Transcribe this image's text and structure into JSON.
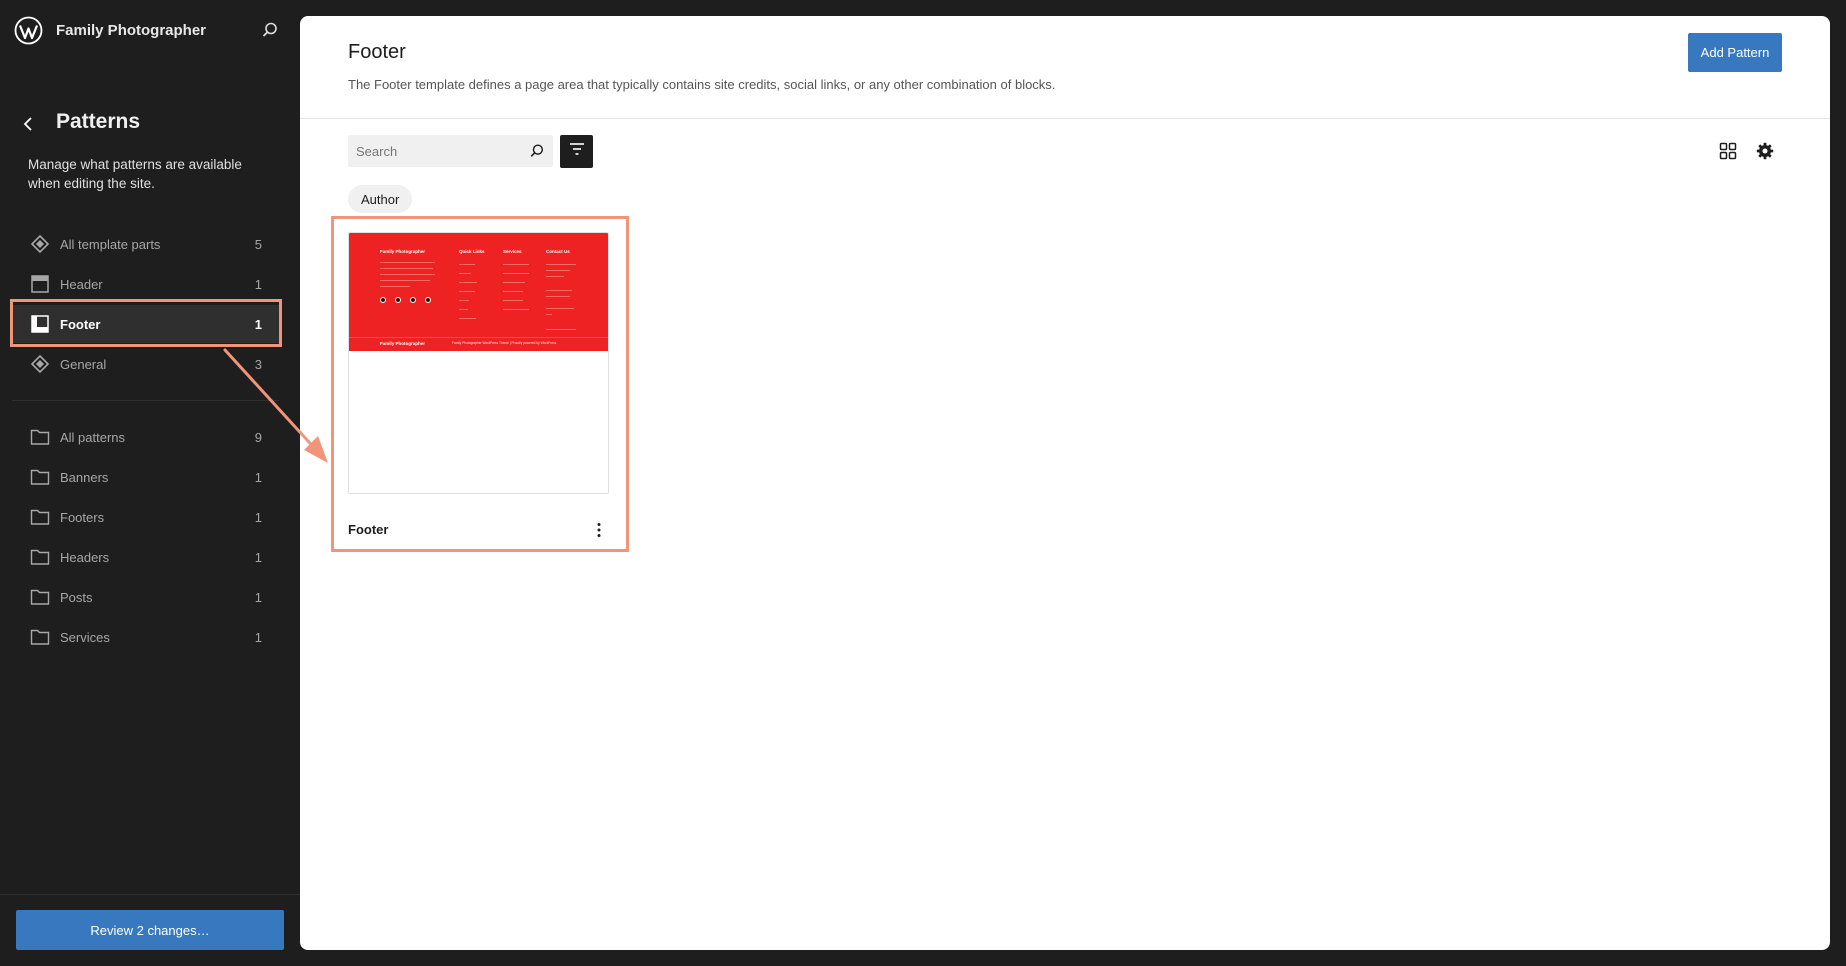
{
  "site": {
    "name": "Family Photographer"
  },
  "panel": {
    "title": "Patterns",
    "description": "Manage what patterns are available when editing the site."
  },
  "nav": {
    "template_parts": [
      {
        "label": "All template parts",
        "count": "5",
        "icon": "symbol-icon"
      },
      {
        "label": "Header",
        "count": "1",
        "icon": "header-icon"
      },
      {
        "label": "Footer",
        "count": "1",
        "icon": "footer-icon",
        "active": true
      },
      {
        "label": "General",
        "count": "3",
        "icon": "symbol-icon"
      }
    ],
    "patterns": [
      {
        "label": "All patterns",
        "count": "9",
        "icon": "folder-icon"
      },
      {
        "label": "Banners",
        "count": "1",
        "icon": "folder-icon"
      },
      {
        "label": "Footers",
        "count": "1",
        "icon": "folder-icon"
      },
      {
        "label": "Headers",
        "count": "1",
        "icon": "folder-icon"
      },
      {
        "label": "Posts",
        "count": "1",
        "icon": "folder-icon"
      },
      {
        "label": "Services",
        "count": "1",
        "icon": "folder-icon"
      }
    ]
  },
  "review_button": "Review 2 changes…",
  "main": {
    "title": "Footer",
    "description": "The Footer template defines a page area that typically contains site credits, social links, or any other combination of blocks.",
    "add_button": "Add Pattern",
    "search_placeholder": "Search",
    "filter_chip": "Author",
    "card": {
      "name": "Footer",
      "preview": {
        "background": "#ee2222",
        "col1_title": "Family Photographer",
        "col2_title": "Quick Links",
        "col3_title": "Services",
        "col4_title": "Contact Us",
        "bottom_left": "Family Photographer",
        "bottom_right": "Family Photographer WordPress Theme | Proudly powered by WordPress"
      }
    }
  },
  "colors": {
    "sidebar_bg": "#1e1e1e",
    "accent": "#3878bf",
    "highlight": "#f0957a"
  }
}
